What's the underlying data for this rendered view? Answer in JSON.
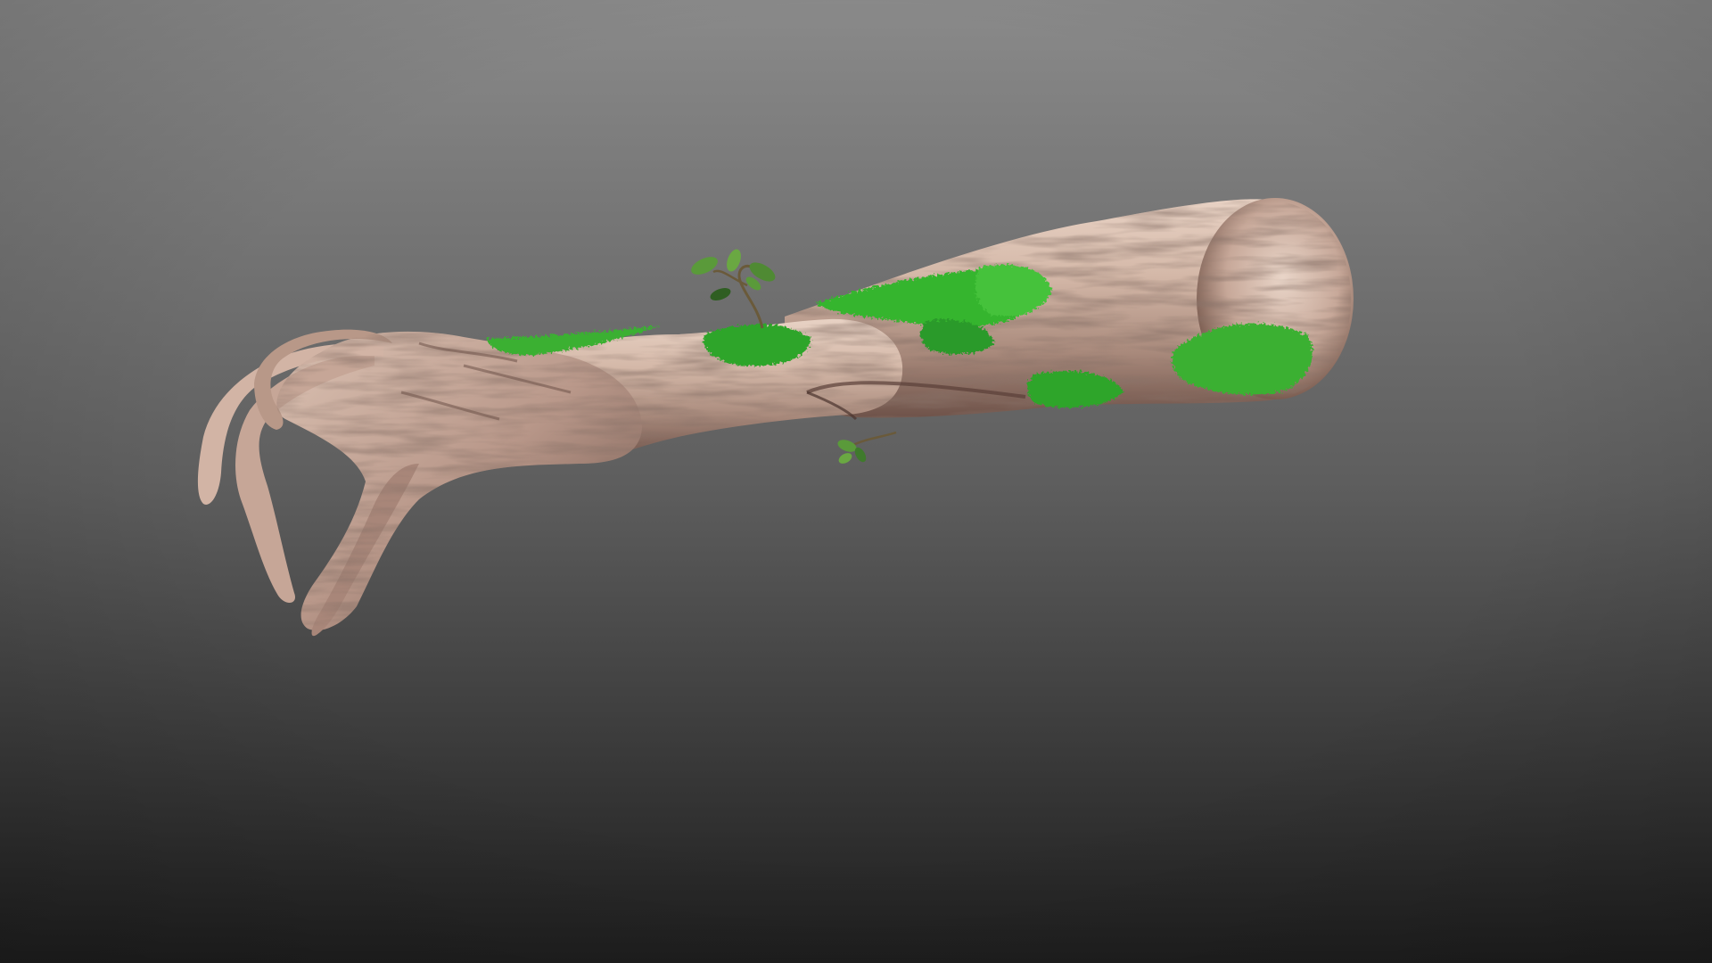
{
  "scene": {
    "colors": {
      "background_top": "#8a8a8a",
      "background_mid": "#5e5e5e",
      "background_bottom": "#1e1e1e",
      "bark_light": "#e2c9bb",
      "bark_mid": "#bf9d8d",
      "bark_shadow": "#7d5e52",
      "bark_dark": "#4c3630",
      "moss_light": "#5fd24a",
      "moss_mid": "#2fa52b",
      "moss_dark": "#1a6d1c",
      "leaf": "#5a9a3a",
      "leaf_dark": "#2f5e22",
      "stem": "#6a5a3a"
    }
  }
}
